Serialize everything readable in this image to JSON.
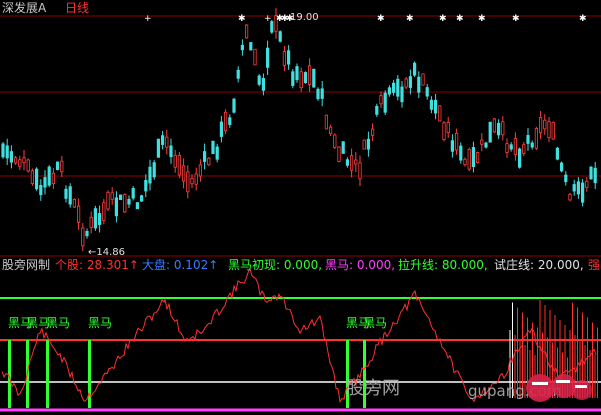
{
  "header": {
    "title": "深发展A",
    "period": "日线"
  },
  "price_panel": {
    "high_label": "19.00",
    "low_label": "←14.86"
  },
  "indicator_bar": {
    "name": "股旁网制",
    "items": [
      {
        "text": "个股: 28.301↑",
        "color": "#ff3030"
      },
      {
        "text": "大盘: 0.102↑",
        "color": "#3a7bff"
      },
      {
        "text": "黑马初现: 0.000,",
        "color": "#30ff30"
      },
      {
        "text": "黑马: 0.000,",
        "color": "#ff40ff"
      },
      {
        "text": "拉升线: 80.000,",
        "color": "#30ff30"
      },
      {
        "text": "试庄线: 20.000,",
        "color": "#e0e0e0"
      },
      {
        "text": "强",
        "color": "#ff3030"
      }
    ]
  },
  "signals": {
    "heima_label": "黑马"
  },
  "watermark": {
    "text1": "股旁网",
    "text2": "gupang.com"
  },
  "colors": {
    "up": "#ff4040",
    "down": "#40e0e0",
    "line80": "#30ff30",
    "line_mid": "#ff3030",
    "line20": "#ffffff",
    "magenta": "#ff40ff"
  }
}
